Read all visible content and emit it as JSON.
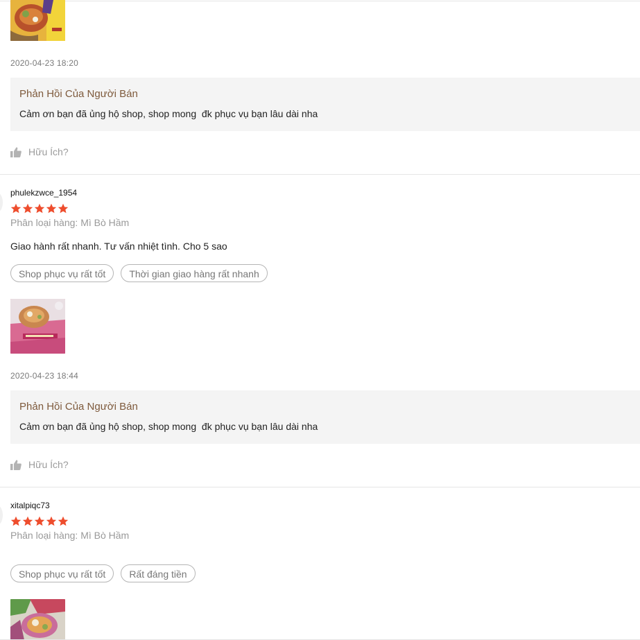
{
  "reviews": [
    {
      "timestamp": "2020-04-23 18:20",
      "reply_title": "Phản Hồi Của Người Bán",
      "reply_text": "Cảm ơn bạn đã ủng hộ shop, shop mong  đk phục vụ bạn lâu dài nha",
      "helpful_label": "Hữu Ích?"
    },
    {
      "username": "phulekzwce_1954",
      "rating": 5,
      "variant": "Phân loại hàng: Mì Bò Hầm",
      "comment": "Giao hành rất nhanh. Tư vấn nhiệt tình. Cho 5 sao",
      "tags": [
        "Shop phục vụ rất tốt",
        "Thời gian giao hàng rất nhanh"
      ],
      "timestamp": "2020-04-23 18:44",
      "reply_title": "Phản Hồi Của Người Bán",
      "reply_text": "Cảm ơn bạn đã ủng hộ shop, shop mong  đk phục vụ bạn lâu dài nha",
      "helpful_label": "Hữu Ích?"
    },
    {
      "username": "xitalpiqc73",
      "rating": 5,
      "variant": "Phân loại hàng: Mì Bò Hầm",
      "tags": [
        "Shop phục vụ rất tốt",
        "Rất đáng tiền"
      ]
    }
  ],
  "colors": {
    "star": "#ee4d2d",
    "reply_title": "#7e5a3c",
    "reply_bg": "#f4f4f4",
    "muted": "#999999"
  },
  "icons": {
    "star": "star-icon",
    "helpful": "thumbs-up-icon"
  }
}
